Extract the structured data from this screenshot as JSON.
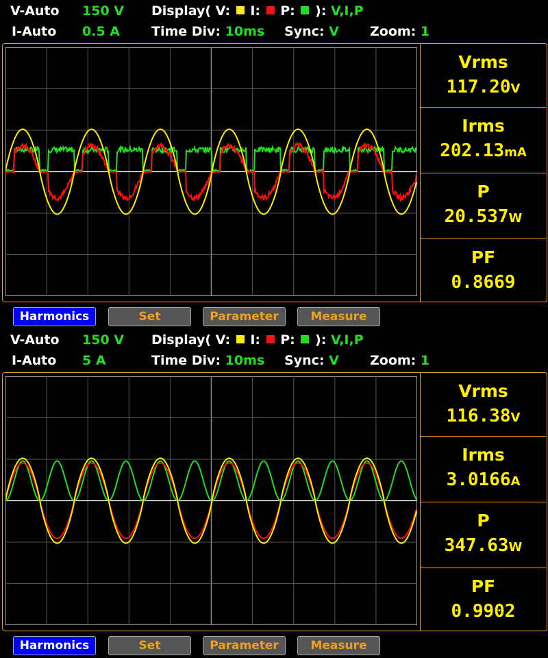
{
  "panels": [
    {
      "v_range_label": "V-Auto",
      "v_range_value": "150 V",
      "i_range_label": "I-Auto",
      "i_range_value": "0.5 A",
      "display_prefix": "Display( V:",
      "display_i": "I:",
      "display_p": "P:",
      "display_suffix": "):",
      "display_value": "V,I,P",
      "time_div_label": "Time  Div:",
      "time_div_value": "10ms",
      "sync_label": "Sync:",
      "sync_value": "V",
      "zoom_label": "Zoom:",
      "zoom_value": "1",
      "measurements": [
        {
          "label": "Vrms",
          "value": "117.20",
          "unit": "V"
        },
        {
          "label": "Irms",
          "value": "202.13",
          "unit": "mA"
        },
        {
          "label": "P",
          "value": "20.537",
          "unit": "W"
        },
        {
          "label": "PF",
          "value": "0.8669",
          "unit": ""
        }
      ],
      "buttons": [
        "Harmonics",
        "Set",
        "Parameter",
        "Measure"
      ],
      "waveform_type": "dimmer"
    },
    {
      "v_range_label": "V-Auto",
      "v_range_value": "150 V",
      "i_range_label": "I-Auto",
      "i_range_value": "5 A",
      "display_prefix": "Display( V:",
      "display_i": "I:",
      "display_p": "P:",
      "display_suffix": "):",
      "display_value": "V,I,P",
      "time_div_label": "Time  Div:",
      "time_div_value": "10ms",
      "sync_label": "Sync:",
      "sync_value": "V",
      "zoom_label": "Zoom:",
      "zoom_value": "1",
      "measurements": [
        {
          "label": "Vrms",
          "value": "116.38",
          "unit": "V"
        },
        {
          "label": "Irms",
          "value": "3.0166",
          "unit": "A"
        },
        {
          "label": "P",
          "value": "347.63",
          "unit": "W"
        },
        {
          "label": "PF",
          "value": "0.9902",
          "unit": ""
        }
      ],
      "buttons": [
        "Harmonics",
        "Set",
        "Parameter",
        "Measure"
      ],
      "waveform_type": "resistive"
    }
  ],
  "colors": {
    "voltage": "#ffee00",
    "current": "#ff1010",
    "power": "#22dd22",
    "border": "#e89a2a",
    "grid": "#555555",
    "active_button": "#0000ff",
    "button": "#555555"
  }
}
